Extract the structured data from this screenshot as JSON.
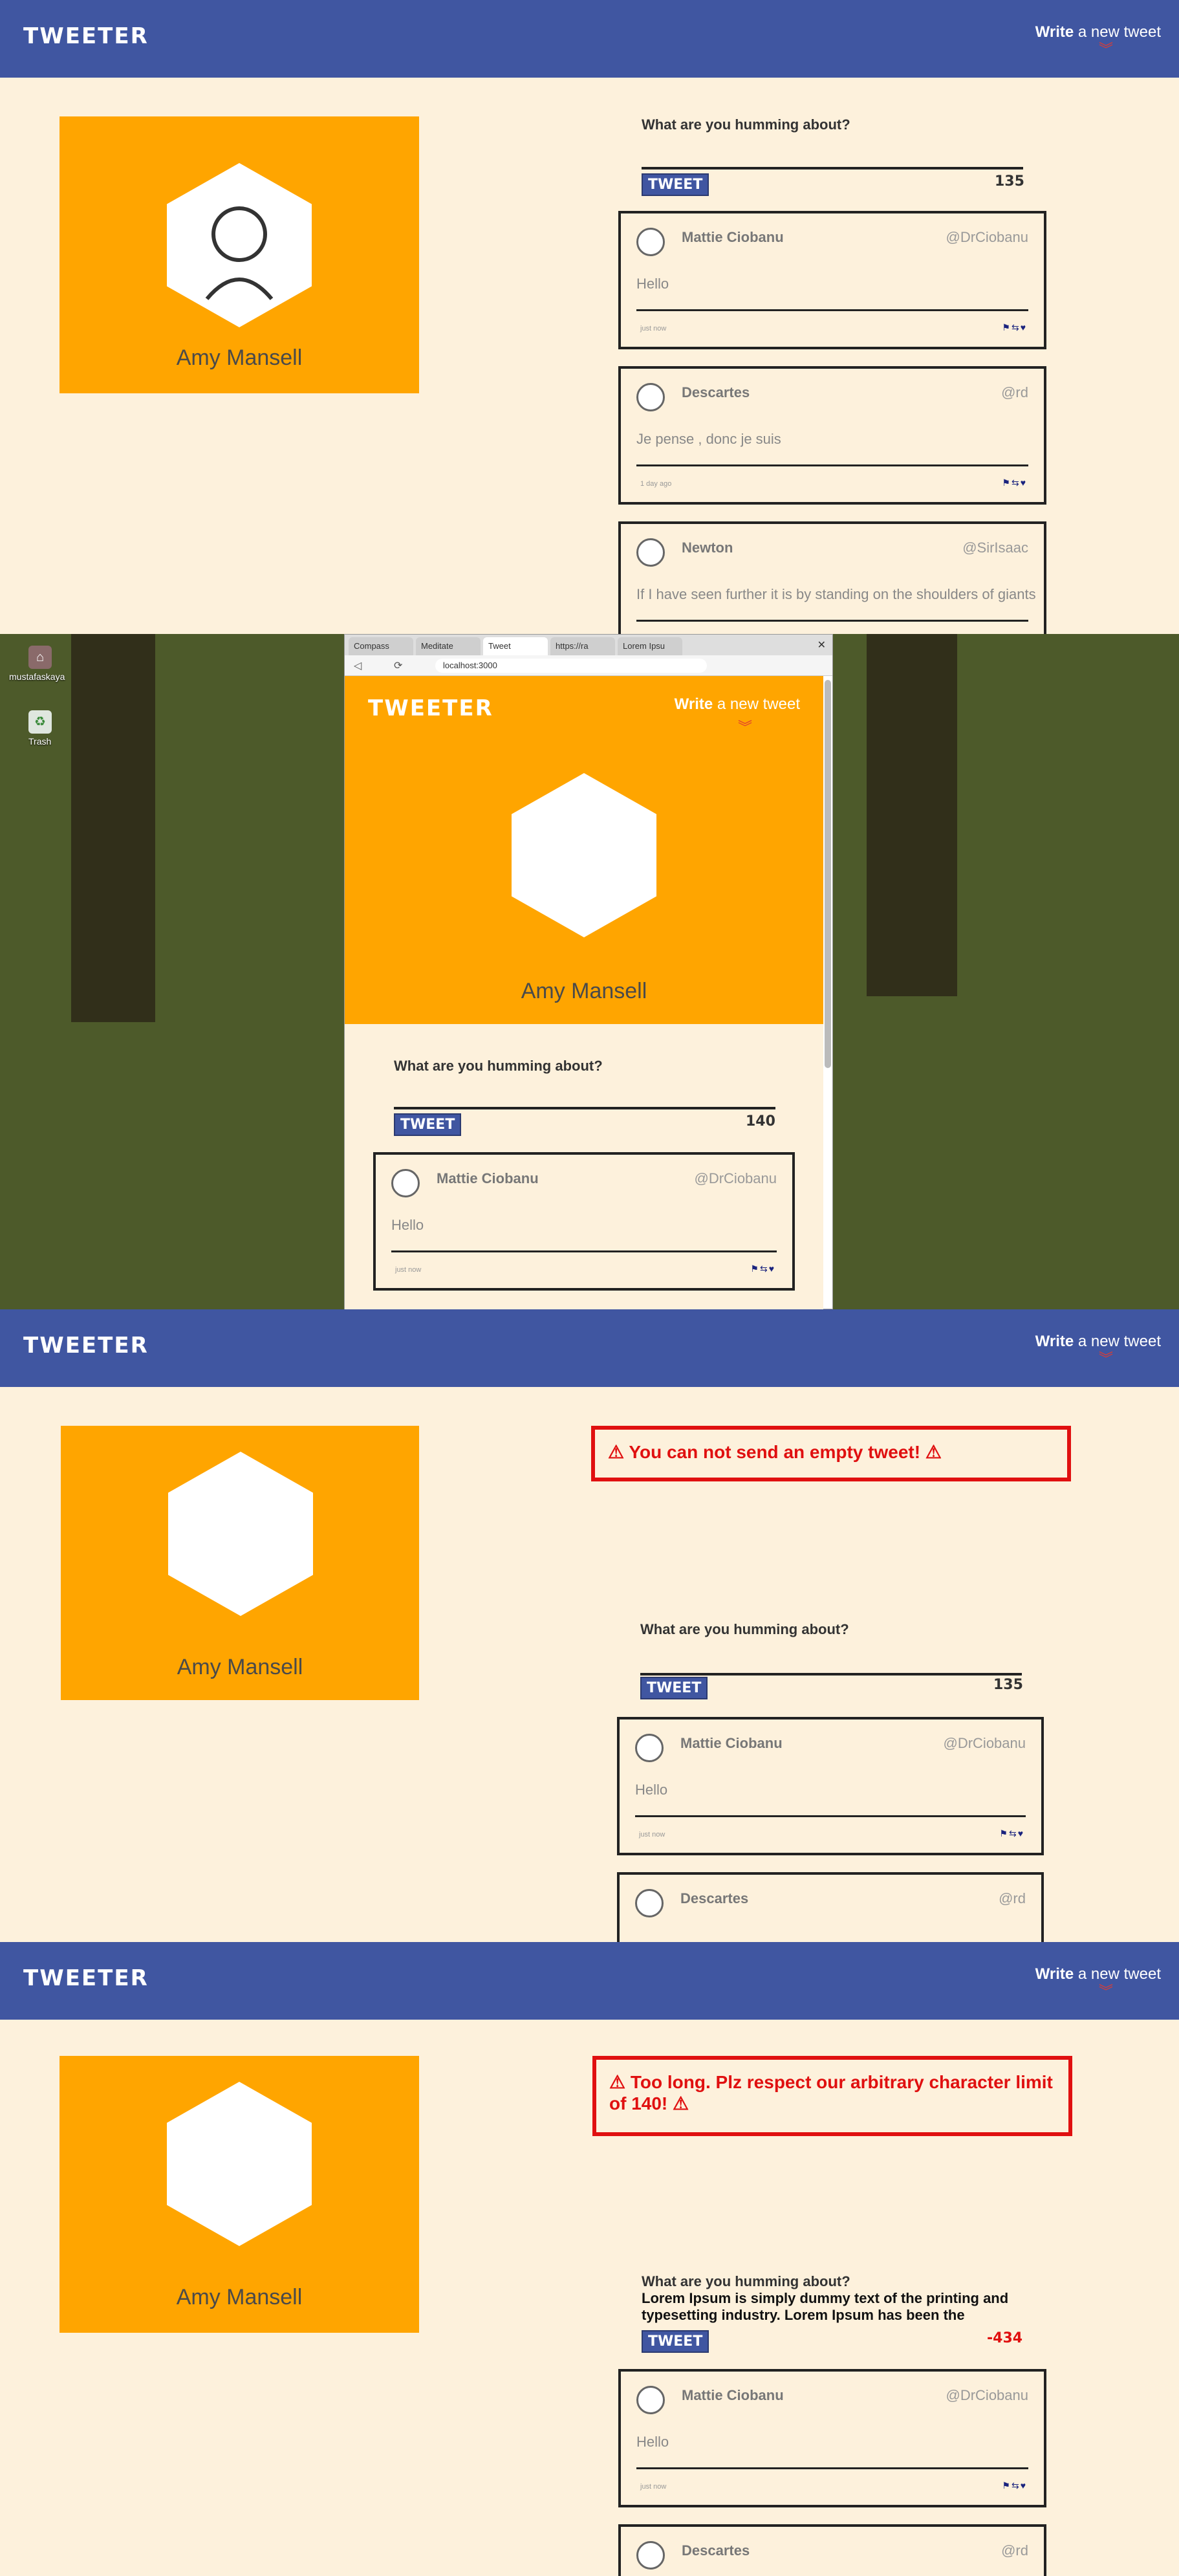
{
  "brand": "TWEETER",
  "nav": {
    "write_bold": "Write",
    "write_rest": " a new tweet",
    "chevron": "»"
  },
  "profile": {
    "name": "Amy Mansell"
  },
  "composer": {
    "prompt": "What are you humming about?",
    "button": "TWEET",
    "count_1": "135",
    "count_2": "140",
    "count_3": "135",
    "count_4": "-434",
    "long_text_line1": "Lorem Ipsum is simply dummy text of the printing and",
    "long_text_line2": "typesetting industry. Lorem Ipsum has been the"
  },
  "errors": {
    "empty": "You can not send an empty tweet!",
    "too_long": "Too long. Plz respect our arbitrary character limit of 140!"
  },
  "tweets": [
    {
      "name": "Mattie Ciobanu",
      "handle": "@DrCiobanu",
      "body": "Hello",
      "time": "just now",
      "icons": "⚑⇆♥"
    },
    {
      "name": "Descartes",
      "handle": "@rd",
      "body": "Je pense , donc je suis",
      "time": "1 day ago",
      "icons": "⚑⇆♥"
    },
    {
      "name": "Newton",
      "handle": "@SirIsaac",
      "body": "If I have seen further it is by standing on the shoulders of giants",
      "time": "",
      "icons": ""
    }
  ],
  "desktop": {
    "icons": [
      {
        "label": "mustafaskaya"
      },
      {
        "label": "Trash"
      }
    ],
    "tabs": [
      "Compass",
      "Meditate",
      "Tweet",
      "https://ra",
      "Lorem Ipsu"
    ],
    "url": "localhost:3000"
  },
  "colors": {
    "nav": "#4056a1",
    "accent": "#ffa500",
    "error": "#e01010",
    "background": "#fdf1dc"
  }
}
